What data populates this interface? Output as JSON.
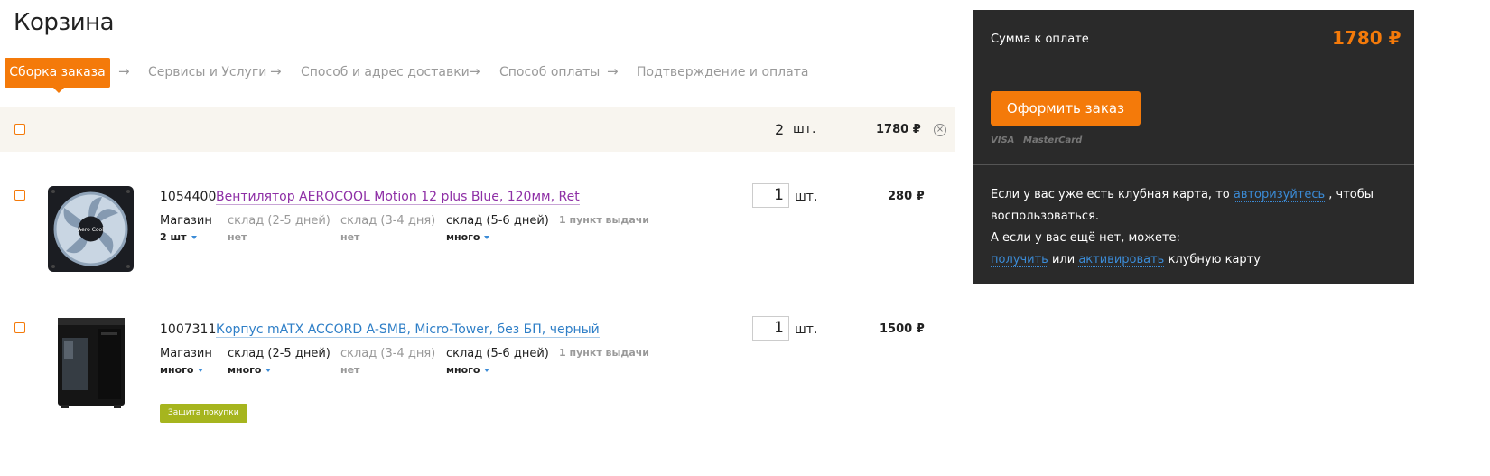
{
  "page": {
    "title": "Корзина"
  },
  "steps": {
    "active": "Сборка заказа",
    "items": [
      "Сервисы и Услуги",
      "Способ и адрес доставки",
      "Способ оплаты",
      "Подтверждение и оплата"
    ],
    "arrow": "→"
  },
  "summary": {
    "count": "2",
    "unit": "шт.",
    "total": "1780 ₽",
    "remove_icon": "×"
  },
  "products": [
    {
      "code": "1054400",
      "name": "Вентилятор AEROCOOL Motion 12 plus Blue, 120мм, Ret",
      "link_color": "#8e2fa6",
      "availability": [
        {
          "label": "Магазин",
          "value": "2 шт",
          "caret": true,
          "muted": false
        },
        {
          "label": "склад (2-5 дней)",
          "value": "нет",
          "caret": false,
          "muted": true
        },
        {
          "label": "склад (3-4 дня)",
          "value": "нет",
          "caret": false,
          "muted": true
        },
        {
          "label": "склад (5-6 дней)",
          "value": "много",
          "caret": true,
          "muted": false
        }
      ],
      "pickup": "1 пункт выдачи",
      "qty": "1",
      "unit": "шт.",
      "price": "280 ₽",
      "image_icon": "fan-icon",
      "image_text": "Aero Cool"
    },
    {
      "code": "1007311",
      "name": "Корпус mATX ACCORD A-SMB, Micro-Tower, без БП, черный",
      "link_color": "#2f7fc7",
      "availability": [
        {
          "label": "Магазин",
          "value": "много",
          "caret": true,
          "muted": false
        },
        {
          "label": "склад (2-5 дней)",
          "value": "много",
          "caret": true,
          "muted": false
        },
        {
          "label": "склад (3-4 дня)",
          "value": "нет",
          "caret": false,
          "muted": true
        },
        {
          "label": "склад (5-6 дней)",
          "value": "много",
          "caret": true,
          "muted": false
        }
      ],
      "pickup": "1 пункт выдачи",
      "qty": "1",
      "unit": "шт.",
      "price": "1500 ₽",
      "image_icon": "pc-case-icon",
      "badge": "Защита покупки"
    }
  ],
  "panel": {
    "sum_label": "Сумма к оплате",
    "sum_value": "1780 ₽",
    "order_button": "Оформить заказ",
    "cards": [
      "VISA",
      "MasterCard"
    ],
    "club": {
      "line1_pre": "Если у вас уже есть клубная карта, то ",
      "line1_link": "авторизуйтесь",
      "line1_post": " , чтобы",
      "line2": "воспользоваться.",
      "line3": "А если у вас ещё нет, можете:",
      "link_get": "получить",
      "or": " или ",
      "link_activate": "активировать",
      "line4_post": " клубную карту"
    }
  },
  "colors": {
    "accent": "#f47a0a",
    "panel_bg": "#2a2a2a",
    "link_blue": "#3b8bd6",
    "badge_green": "#a6b51e"
  }
}
